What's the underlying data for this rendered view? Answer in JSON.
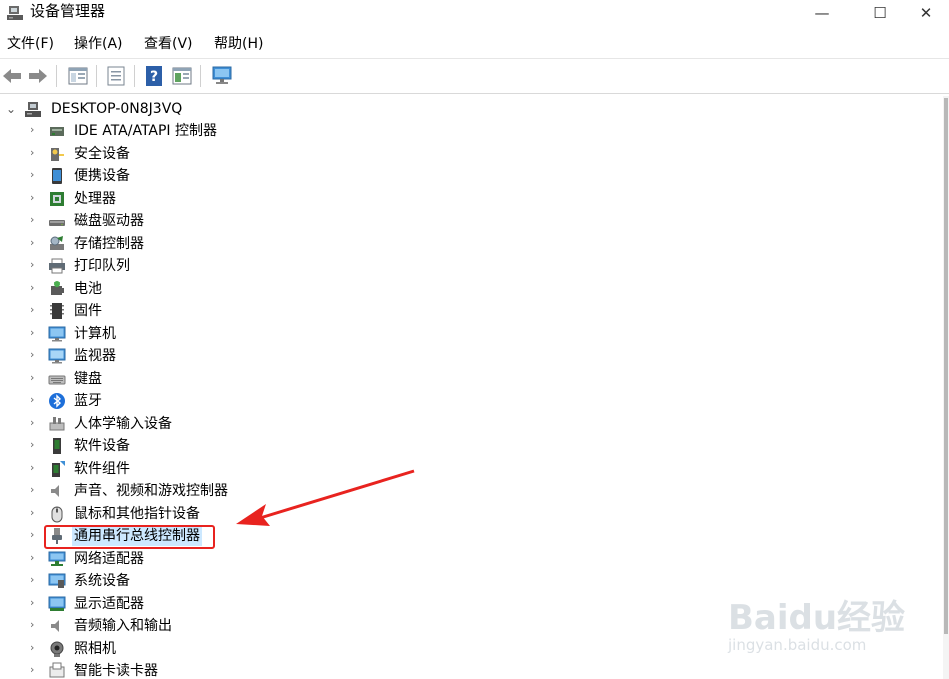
{
  "window": {
    "title": "设备管理器",
    "minimize": "—",
    "maximize": "☐",
    "close": "✕"
  },
  "menu": [
    {
      "label": "文件(F)"
    },
    {
      "label": "操作(A)"
    },
    {
      "label": "查看(V)"
    },
    {
      "label": "帮助(H)"
    }
  ],
  "toolbar": {
    "buttons": [
      "back-icon",
      "forward-icon",
      "show-hide-tree-icon",
      "properties-icon",
      "help-icon",
      "update-driver-icon",
      "scan-hardware-icon"
    ]
  },
  "tree": {
    "root": {
      "label": "DESKTOP-0N8J3VQ",
      "expanded": true,
      "icon": "computer-icon"
    },
    "items": [
      {
        "label": "IDE ATA/ATAPI 控制器",
        "icon": "ide-controller-icon"
      },
      {
        "label": "安全设备",
        "icon": "security-device-icon"
      },
      {
        "label": "便携设备",
        "icon": "portable-device-icon"
      },
      {
        "label": "处理器",
        "icon": "processor-icon"
      },
      {
        "label": "磁盘驱动器",
        "icon": "disk-drive-icon"
      },
      {
        "label": "存储控制器",
        "icon": "storage-controller-icon"
      },
      {
        "label": "打印队列",
        "icon": "printer-icon"
      },
      {
        "label": "电池",
        "icon": "battery-icon"
      },
      {
        "label": "固件",
        "icon": "firmware-icon"
      },
      {
        "label": "计算机",
        "icon": "computer-monitor-icon"
      },
      {
        "label": "监视器",
        "icon": "monitor-icon"
      },
      {
        "label": "键盘",
        "icon": "keyboard-icon"
      },
      {
        "label": "蓝牙",
        "icon": "bluetooth-icon"
      },
      {
        "label": "人体学输入设备",
        "icon": "hid-icon"
      },
      {
        "label": "软件设备",
        "icon": "software-device-icon"
      },
      {
        "label": "软件组件",
        "icon": "software-component-icon"
      },
      {
        "label": "声音、视频和游戏控制器",
        "icon": "sound-icon"
      },
      {
        "label": "鼠标和其他指针设备",
        "icon": "mouse-icon"
      },
      {
        "label": "通用串行总线控制器",
        "icon": "usb-icon",
        "selected": true
      },
      {
        "label": "网络适配器",
        "icon": "network-adapter-icon"
      },
      {
        "label": "系统设备",
        "icon": "system-device-icon"
      },
      {
        "label": "显示适配器",
        "icon": "display-adapter-icon"
      },
      {
        "label": "音频输入和输出",
        "icon": "audio-io-icon"
      },
      {
        "label": "照相机",
        "icon": "camera-icon"
      },
      {
        "label": "智能卡读卡器",
        "icon": "smart-card-reader-icon"
      }
    ]
  },
  "watermark": {
    "brand": "Baidu经验",
    "url": "jingyan.baidu.com"
  },
  "colors": {
    "highlight_border": "#e8231f",
    "selection_bg": "#cce8ff",
    "arrow": "#e8231f"
  }
}
